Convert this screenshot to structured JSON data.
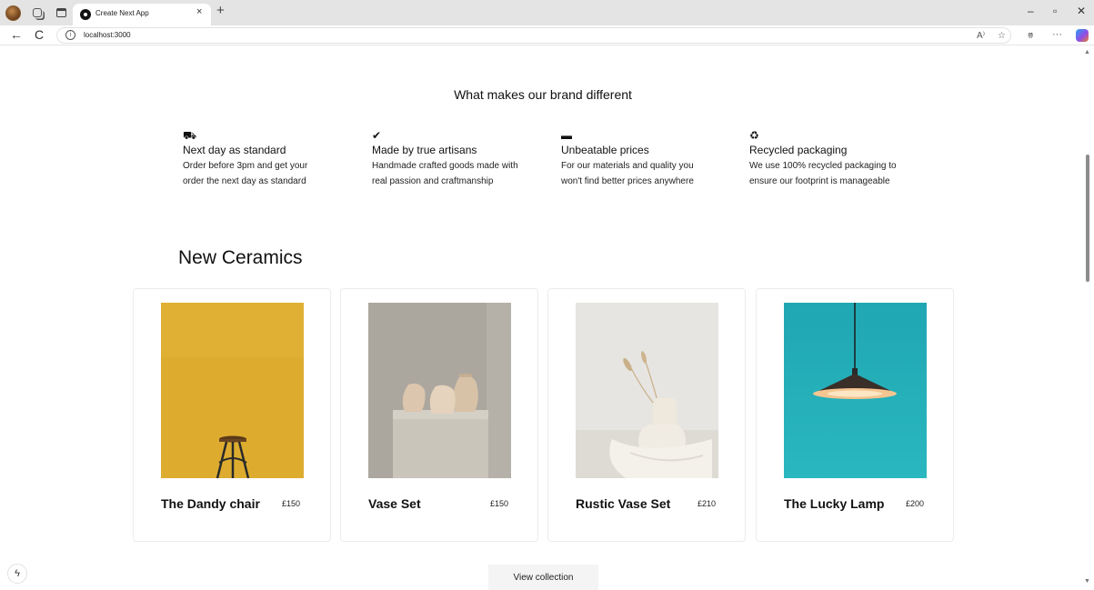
{
  "browser": {
    "tab_title": "Create Next App",
    "tab_close": "×",
    "new_tab": "+",
    "url": "localhost:3000",
    "info_icon": "i",
    "back": "←",
    "reload": "C",
    "read_aloud": "A⁾",
    "favorite": "☆",
    "favorites": "⩷",
    "more": "···",
    "minimize": "–",
    "restore": "▫",
    "close": "✕"
  },
  "brand": {
    "heading": "What makes our brand different",
    "features": [
      {
        "icon": "truck-icon",
        "glyph": "⛟",
        "title": "Next day as standard",
        "text": "Order before 3pm and get your order the next day as standard"
      },
      {
        "icon": "checkmark-icon",
        "glyph": "✔",
        "title": "Made by true artisans",
        "text": "Handmade crafted goods made with real passion and craftmanship"
      },
      {
        "icon": "credit-card-icon",
        "glyph": "▬",
        "title": "Unbeatable prices",
        "text": "For our materials and quality you won't find better prices anywhere"
      },
      {
        "icon": "recycle-icon",
        "glyph": "♻",
        "title": "Recycled packaging",
        "text": "We use 100% recycled packaging to ensure our footprint is manageable"
      }
    ]
  },
  "ceramics": {
    "title": "New Ceramics",
    "products": [
      {
        "name": "The Dandy chair",
        "price": "£150",
        "image": "chair-photo"
      },
      {
        "name": "Vase Set",
        "price": "£150",
        "image": "vase-set-photo"
      },
      {
        "name": "Rustic Vase Set",
        "price": "£210",
        "image": "rustic-vase-photo"
      },
      {
        "name": "The Lucky Lamp",
        "price": "£200",
        "image": "lamp-photo"
      }
    ],
    "view_collection": "View collection"
  },
  "next_badge": "ϟ",
  "colors": {
    "chair_bg": "#ddac2f",
    "vase_bg": "#aba79f",
    "rustic_bg": "#e7e5e1",
    "lamp_bg": "#22aab4"
  }
}
